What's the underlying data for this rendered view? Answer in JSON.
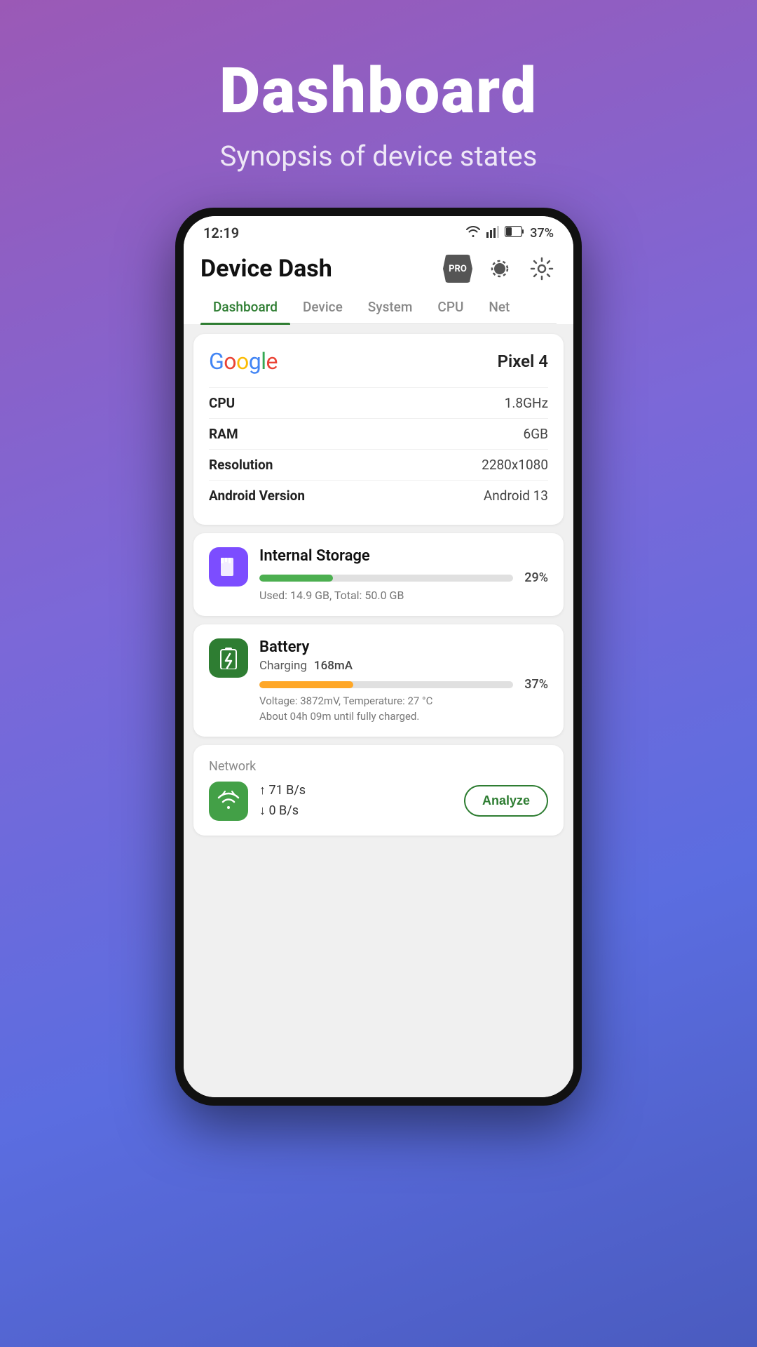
{
  "page": {
    "title": "Dashboard",
    "subtitle": "Synopsis of device states"
  },
  "status_bar": {
    "time": "12:19",
    "battery_percent": "37%"
  },
  "app_bar": {
    "title": "Device Dash",
    "pro_label": "PRO"
  },
  "tabs": [
    {
      "label": "Dashboard",
      "active": true
    },
    {
      "label": "Device",
      "active": false
    },
    {
      "label": "System",
      "active": false
    },
    {
      "label": "CPU",
      "active": false
    },
    {
      "label": "Net",
      "active": false
    }
  ],
  "device_card": {
    "brand": "Google",
    "model": "Pixel 4",
    "specs": [
      {
        "label": "CPU",
        "value": "1.8GHz"
      },
      {
        "label": "RAM",
        "value": "6GB"
      },
      {
        "label": "Resolution",
        "value": "2280x1080"
      },
      {
        "label": "Android Version",
        "value": "Android 13"
      }
    ]
  },
  "storage_card": {
    "title": "Internal Storage",
    "percent": "29%",
    "fill_percent": 29,
    "detail": "Used: 14.9 GB,  Total: 50.0 GB",
    "bar_color": "#4caf50"
  },
  "battery_card": {
    "title": "Battery",
    "status": "Charging",
    "current": "168mA",
    "percent": "37%",
    "fill_percent": 37,
    "voltage": "Voltage: 3872mV,  Temperature: 27 °C",
    "time_left": "About 04h 09m until fully charged.",
    "bar_color": "#ffa726"
  },
  "network_card": {
    "section_label": "Network",
    "upload_speed": "↑ 71 B/s",
    "download_speed": "↓ 0 B/s",
    "analyze_label": "Analyze"
  }
}
